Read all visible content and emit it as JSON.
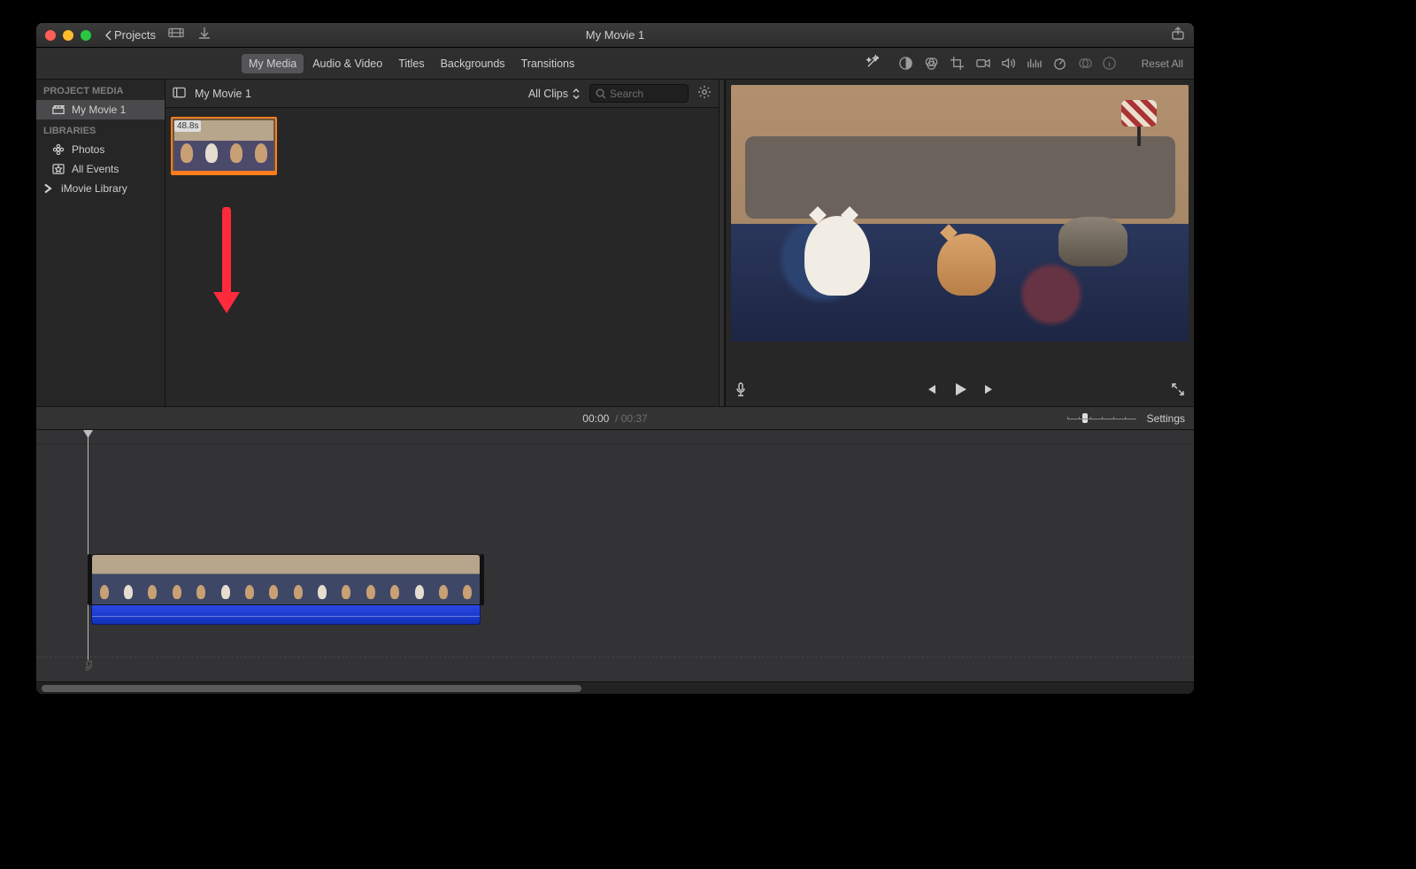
{
  "window": {
    "title": "My Movie 1"
  },
  "titlebar": {
    "back_label": "Projects"
  },
  "tabs": {
    "items": [
      "My Media",
      "Audio & Video",
      "Titles",
      "Backgrounds",
      "Transitions"
    ],
    "active_index": 0
  },
  "adjust": {
    "reset_label": "Reset All"
  },
  "sidebar": {
    "section1": "PROJECT MEDIA",
    "project_item": "My Movie 1",
    "section2": "LIBRARIES",
    "photos": "Photos",
    "all_events": "All Events",
    "library": "iMovie Library"
  },
  "browser": {
    "title": "My Movie 1",
    "filter_label": "All Clips",
    "search_placeholder": "Search",
    "clip": {
      "duration_label": "48.8s"
    }
  },
  "timeline_header": {
    "current": "00:00",
    "separator": "/",
    "total": "00:37",
    "settings_label": "Settings"
  }
}
